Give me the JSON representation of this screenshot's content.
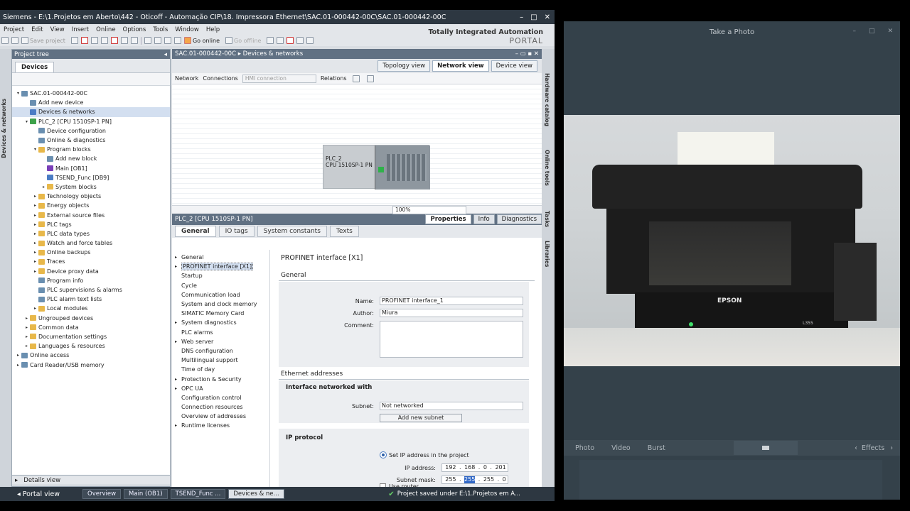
{
  "tia": {
    "title": "Siemens - E:\\1.Projetos em Aberto\\442 - Oticoff - Automação CIP\\18. Impressora Ethernet\\SAC.01-000442-00C\\SAC.01-000442-00C",
    "menu": [
      "Project",
      "Edit",
      "View",
      "Insert",
      "Online",
      "Options",
      "Tools",
      "Window",
      "Help"
    ],
    "toolbar": {
      "save_project": "Save project",
      "go_online": "Go online",
      "go_offline": "Go offline"
    },
    "branding": {
      "line1": "Totally Integrated Automation",
      "line2": "PORTAL"
    },
    "project_tree": {
      "header": "Project tree",
      "tab": "Devices",
      "side_label": "Devices & networks",
      "items": [
        {
          "label": "SAC.01-000442-00C",
          "indent": 0,
          "arrow": "▾",
          "icon": "doc"
        },
        {
          "label": "Add new device",
          "indent": 1,
          "arrow": "",
          "icon": "gear"
        },
        {
          "label": "Devices & networks",
          "indent": 1,
          "arrow": "",
          "icon": "blue",
          "selected": true
        },
        {
          "label": "PLC_2 [CPU 1510SP-1 PN]",
          "indent": 1,
          "arrow": "▾",
          "icon": "grn"
        },
        {
          "label": "Device configuration",
          "indent": 2,
          "arrow": "",
          "icon": "gear"
        },
        {
          "label": "Online & diagnostics",
          "indent": 2,
          "arrow": "",
          "icon": "gear"
        },
        {
          "label": "Program blocks",
          "indent": 2,
          "arrow": "▾",
          "icon": "folder"
        },
        {
          "label": "Add new block",
          "indent": 3,
          "arrow": "",
          "icon": "gear"
        },
        {
          "label": "Main [OB1]",
          "indent": 3,
          "arrow": "",
          "icon": "purple"
        },
        {
          "label": "TSEND_Func [DB9]",
          "indent": 3,
          "arrow": "",
          "icon": "blue"
        },
        {
          "label": "System blocks",
          "indent": 3,
          "arrow": "▸",
          "icon": "folder"
        },
        {
          "label": "Technology objects",
          "indent": 2,
          "arrow": "▸",
          "icon": "folder"
        },
        {
          "label": "Energy objects",
          "indent": 2,
          "arrow": "▸",
          "icon": "folder"
        },
        {
          "label": "External source files",
          "indent": 2,
          "arrow": "▸",
          "icon": "folder"
        },
        {
          "label": "PLC tags",
          "indent": 2,
          "arrow": "▸",
          "icon": "folder"
        },
        {
          "label": "PLC data types",
          "indent": 2,
          "arrow": "▸",
          "icon": "folder"
        },
        {
          "label": "Watch and force tables",
          "indent": 2,
          "arrow": "▸",
          "icon": "folder"
        },
        {
          "label": "Online backups",
          "indent": 2,
          "arrow": "▸",
          "icon": "folder"
        },
        {
          "label": "Traces",
          "indent": 2,
          "arrow": "▸",
          "icon": "folder"
        },
        {
          "label": "Device proxy data",
          "indent": 2,
          "arrow": "▸",
          "icon": "folder"
        },
        {
          "label": "Program info",
          "indent": 2,
          "arrow": "",
          "icon": "gear"
        },
        {
          "label": "PLC supervisions & alarms",
          "indent": 2,
          "arrow": "",
          "icon": "gear"
        },
        {
          "label": "PLC alarm text lists",
          "indent": 2,
          "arrow": "",
          "icon": "gear"
        },
        {
          "label": "Local modules",
          "indent": 2,
          "arrow": "▸",
          "icon": "folder"
        },
        {
          "label": "Ungrouped devices",
          "indent": 1,
          "arrow": "▸",
          "icon": "folder"
        },
        {
          "label": "Common data",
          "indent": 1,
          "arrow": "▸",
          "icon": "folder"
        },
        {
          "label": "Documentation settings",
          "indent": 1,
          "arrow": "▸",
          "icon": "folder"
        },
        {
          "label": "Languages & resources",
          "indent": 1,
          "arrow": "▸",
          "icon": "folder"
        },
        {
          "label": "Online access",
          "indent": 0,
          "arrow": "▸",
          "icon": "gear"
        },
        {
          "label": "Card Reader/USB memory",
          "indent": 0,
          "arrow": "▸",
          "icon": "gear"
        }
      ]
    },
    "details_view": "Details view",
    "editor": {
      "title": "SAC.01-000442-00C ▸ Devices & networks",
      "view_tabs": [
        "Topology view",
        "Network view",
        "Device view"
      ],
      "netbar": {
        "network": "Network",
        "connections": "Connections",
        "hmi": "HMI connection",
        "relations": "Relations"
      },
      "plc": {
        "name": "PLC_2",
        "cpu": "CPU 1510SP-1 PN"
      },
      "zoom": "100%"
    },
    "properties": {
      "title": "PLC_2 [CPU 1510SP-1 PN]",
      "tabs": [
        "Properties",
        "Info",
        "Diagnostics"
      ],
      "subtabs": [
        "General",
        "IO tags",
        "System constants",
        "Texts"
      ],
      "nav": [
        {
          "label": "General",
          "arrow": "▸"
        },
        {
          "label": "PROFINET interface [X1]",
          "arrow": "▸",
          "selected": true
        },
        {
          "label": "Startup",
          "arrow": ""
        },
        {
          "label": "Cycle",
          "arrow": ""
        },
        {
          "label": "Communication load",
          "arrow": ""
        },
        {
          "label": "System and clock memory",
          "arrow": ""
        },
        {
          "label": "SIMATIC Memory Card",
          "arrow": ""
        },
        {
          "label": "System diagnostics",
          "arrow": "▸"
        },
        {
          "label": "PLC alarms",
          "arrow": ""
        },
        {
          "label": "Web server",
          "arrow": "▸"
        },
        {
          "label": "DNS configuration",
          "arrow": ""
        },
        {
          "label": "Multilingual support",
          "arrow": ""
        },
        {
          "label": "Time of day",
          "arrow": ""
        },
        {
          "label": "Protection & Security",
          "arrow": "▸"
        },
        {
          "label": "OPC UA",
          "arrow": "▸"
        },
        {
          "label": "Configuration control",
          "arrow": ""
        },
        {
          "label": "Connection resources",
          "arrow": ""
        },
        {
          "label": "Overview of addresses",
          "arrow": ""
        },
        {
          "label": "Runtime licenses",
          "arrow": "▸"
        }
      ],
      "form": {
        "heading": "PROFINET interface [X1]",
        "general": "General",
        "name_label": "Name:",
        "name_value": "PROFINET interface_1",
        "author_label": "Author:",
        "author_value": "Miura",
        "comment_label": "Comment:",
        "eth_heading": "Ethernet addresses",
        "iface_heading": "Interface networked with",
        "subnet_label": "Subnet:",
        "subnet_value": "Not networked",
        "add_subnet": "Add new subnet",
        "ip_heading": "IP protocol",
        "set_ip": "Set IP address in the project",
        "ip_label": "IP address:",
        "ip": [
          "192",
          "168",
          "0",
          "201"
        ],
        "mask_label": "Subnet mask:",
        "mask": [
          "255",
          "255",
          "255",
          "0"
        ],
        "use_router": "Use router"
      }
    },
    "right_strip": [
      "Hardware catalog",
      "Online tools",
      "Tasks",
      "Libraries"
    ],
    "portal": {
      "portal_view": "Portal view",
      "tabs": [
        "Overview",
        "Main (OB1)",
        "TSEND_Func ...",
        "Devices & ne..."
      ],
      "status": "Project saved under E:\\1.Projetos em A..."
    }
  },
  "camera": {
    "title": "Take a Photo",
    "brand": "EPSON",
    "model": "L355",
    "modes": [
      "Photo",
      "Video",
      "Burst"
    ],
    "effects": "Effects"
  },
  "colors": {
    "tia_title": "#2d3741",
    "panel_header": "#617183",
    "selection": "#d3dff0",
    "cam_bg": "#34414a"
  }
}
